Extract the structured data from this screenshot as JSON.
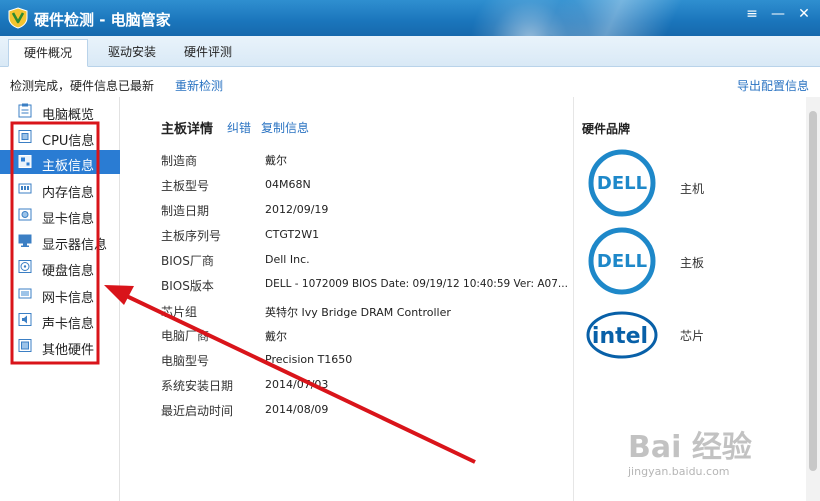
{
  "window": {
    "title": "硬件检测 - 电脑管家",
    "controls": {
      "menu": "≡",
      "minimize": "—",
      "close": "✕"
    }
  },
  "tabs": [
    {
      "label": "硬件概况",
      "active": true
    },
    {
      "label": "驱动安装",
      "active": false
    },
    {
      "label": "硬件评测",
      "active": false
    }
  ],
  "toolbar": {
    "status": "检测完成，硬件信息已最新",
    "recheck": "重新检测",
    "export": "导出配置信息"
  },
  "sidebar": {
    "items": [
      {
        "label": "电脑概览",
        "icon": "clipboard-icon"
      },
      {
        "label": "CPU信息",
        "icon": "cpu-icon"
      },
      {
        "label": "主板信息",
        "icon": "motherboard-icon",
        "active": true
      },
      {
        "label": "内存信息",
        "icon": "memory-icon"
      },
      {
        "label": "显卡信息",
        "icon": "graphics-card-icon"
      },
      {
        "label": "显示器信息",
        "icon": "monitor-icon"
      },
      {
        "label": "硬盘信息",
        "icon": "hard-disk-icon"
      },
      {
        "label": "网卡信息",
        "icon": "network-card-icon"
      },
      {
        "label": "声卡信息",
        "icon": "sound-card-icon"
      },
      {
        "label": "其他硬件",
        "icon": "other-hardware-icon"
      }
    ]
  },
  "main": {
    "title": "主板详情",
    "correct_link": "纠错",
    "copy_link": "复制信息",
    "rows": [
      {
        "label": "制造商",
        "value": "戴尔"
      },
      {
        "label": "主板型号",
        "value": "04M68N"
      },
      {
        "label": "制造日期",
        "value": "2012/09/19"
      },
      {
        "label": "主板序列号",
        "value": "CTGT2W1"
      },
      {
        "label": "BIOS厂商",
        "value": "Dell Inc."
      },
      {
        "label": "BIOS版本",
        "value": "DELL   - 1072009 BIOS Date: 09/19/12 10:40:59 Ver: A07..."
      },
      {
        "label": "芯片组",
        "value": "英特尔 Ivy Bridge DRAM Controller"
      },
      {
        "label": "电脑厂商",
        "value": "戴尔"
      },
      {
        "label": "电脑型号",
        "value": "Precision T1650"
      },
      {
        "label": "系统安装日期",
        "value": "2014/07/03"
      },
      {
        "label": "最近启动时间",
        "value": "2014/08/09"
      }
    ]
  },
  "brands": {
    "title": "硬件品牌",
    "items": [
      {
        "logo_text": "DELL",
        "label": "主机"
      },
      {
        "logo_text": "DELL",
        "label": "主板"
      },
      {
        "logo_text": "intel",
        "label": "芯片"
      }
    ]
  },
  "watermark": {
    "brand": "Bai 经验",
    "url": "jingyan.baidu.com"
  },
  "colors": {
    "titlebar": "#1a75bb",
    "accent": "#2a7cd3",
    "link": "#2a73c2",
    "annotation": "#d9141a",
    "dell_blue": "#1e88c9",
    "intel_blue": "#0860a8"
  }
}
